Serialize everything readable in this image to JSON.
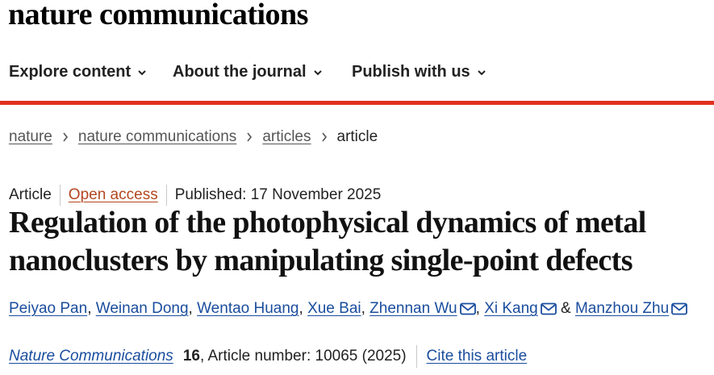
{
  "site": {
    "logo": "nature communications"
  },
  "nav": {
    "items": [
      {
        "label": "Explore content"
      },
      {
        "label": "About the journal"
      },
      {
        "label": "Publish with us"
      }
    ]
  },
  "breadcrumb": {
    "items": [
      "nature",
      "nature communications",
      "articles"
    ],
    "current": "article"
  },
  "article": {
    "type": "Article",
    "access": "Open access",
    "published": "Published: 17 November 2025",
    "title": "Regulation of the photophysical dynamics of metal nanoclusters by manipulating single-point defects",
    "authors": [
      {
        "name": "Peiyao Pan",
        "sep": ", "
      },
      {
        "name": "Weinan Dong",
        "sep": ", "
      },
      {
        "name": "Wentao Huang",
        "sep": ", "
      },
      {
        "name": "Xue Bai",
        "sep": ", "
      },
      {
        "name": "Zhennan Wu",
        "sep": ", "
      },
      {
        "name": "Xi Kang",
        "sep": " & "
      },
      {
        "name": "Manzhou Zhu",
        "sep": ""
      }
    ],
    "journal": "Nature Communications",
    "volume": "16",
    "article_number": ", Article number: 10065 (2025)",
    "cite_label": "Cite this article"
  },
  "colors": {
    "accent_rule": "#e0301e",
    "link": "#1a4d9e",
    "open_access": "#b3471f"
  },
  "icons": {
    "nav_chevron": "chevron-down-icon",
    "breadcrumb_separator": "chevron-right-icon",
    "author_contact": "envelope-icon"
  }
}
